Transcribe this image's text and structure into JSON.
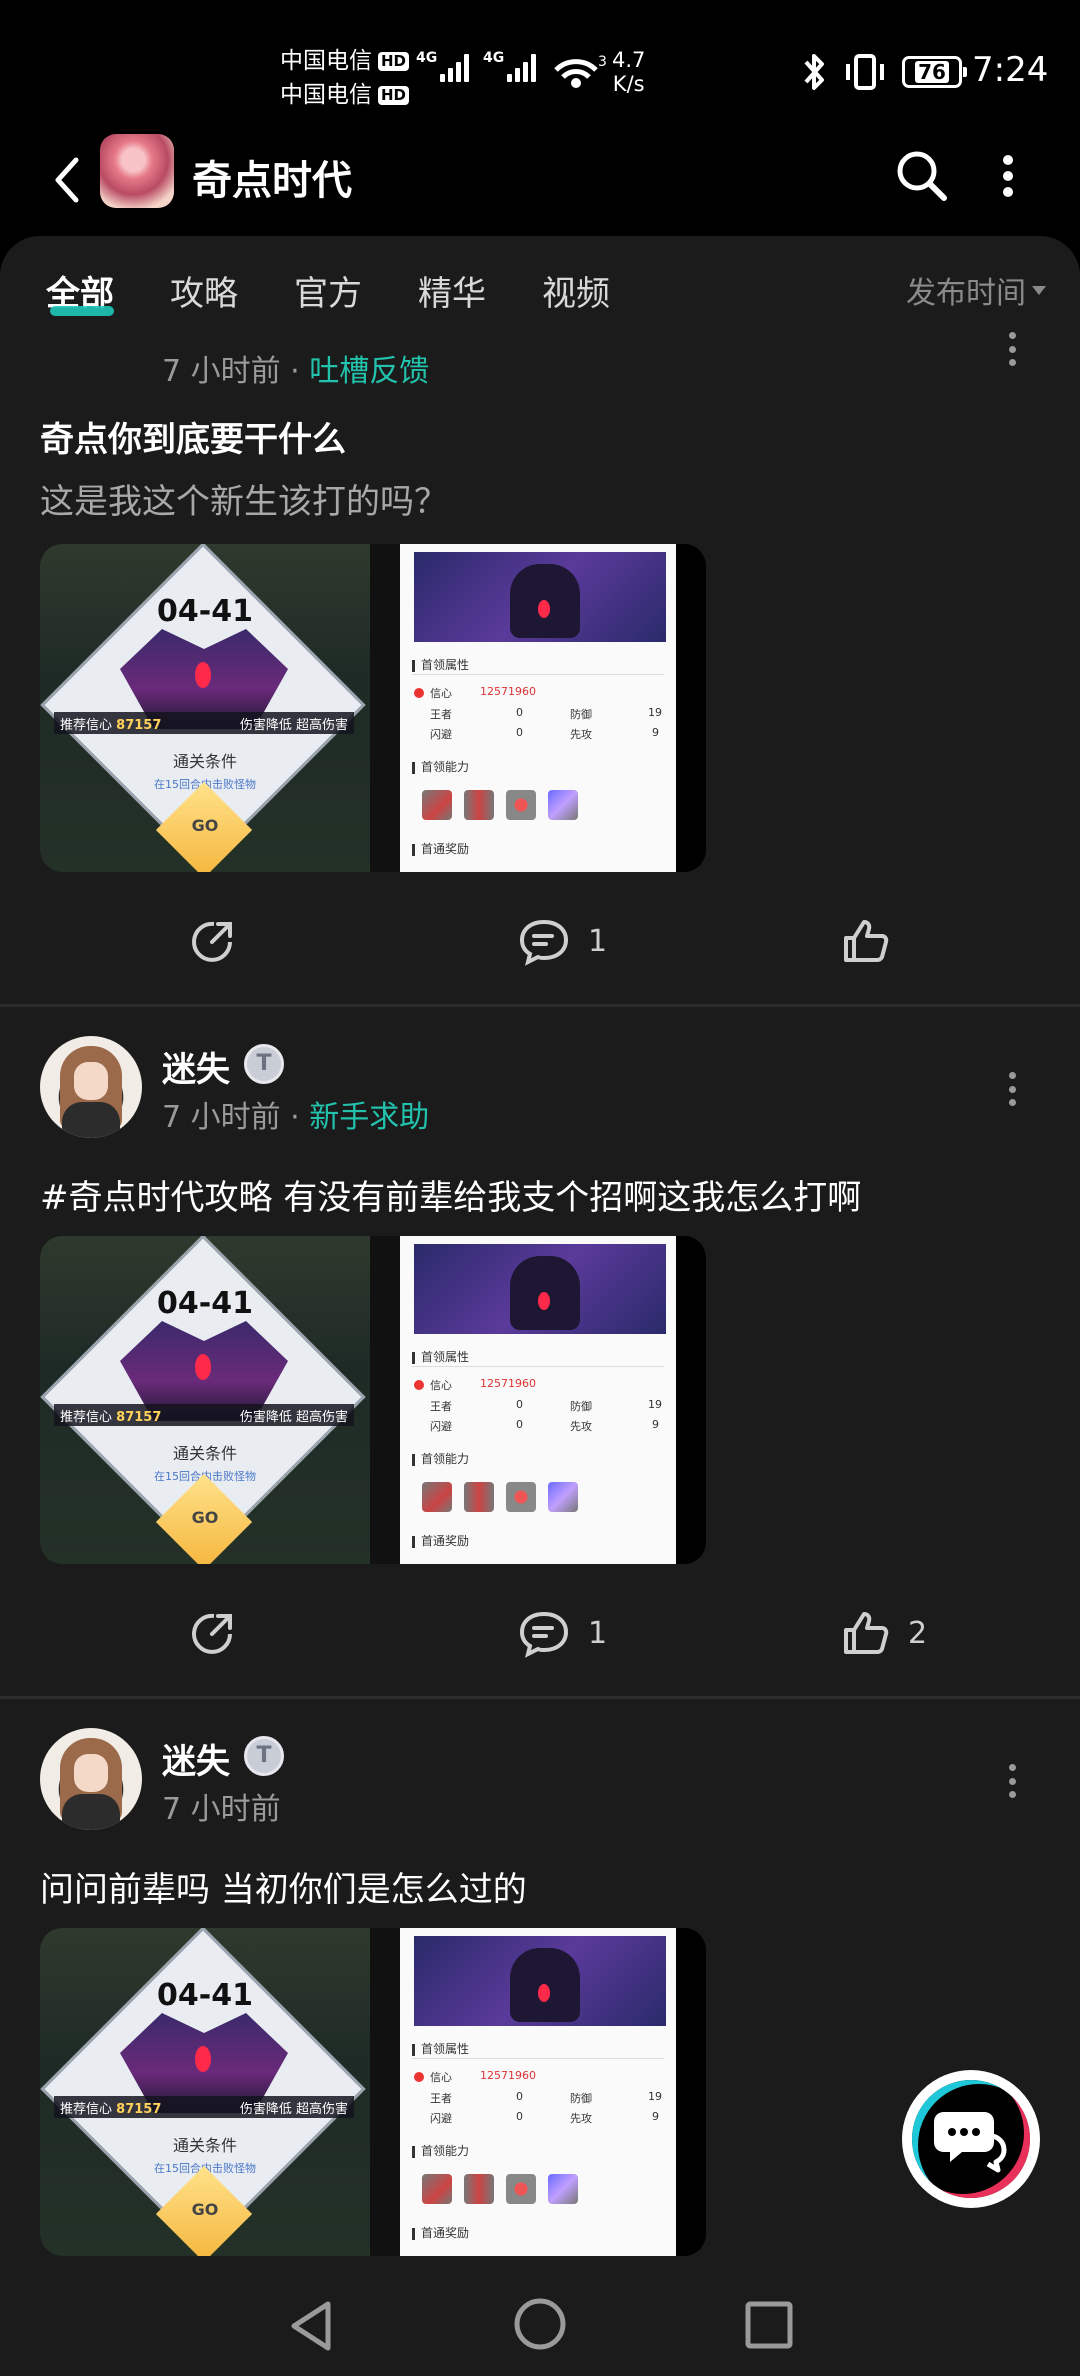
{
  "status_bar": {
    "carrier_1": "中国电信",
    "carrier_2": "中国电信",
    "hd_label": "HD",
    "network_1": "4G",
    "network_2": "4G",
    "wifi_badge": "3",
    "speed_value": "4.7",
    "speed_unit": "K/s",
    "battery": "76",
    "time": "7:24"
  },
  "app_bar": {
    "title": "奇点时代",
    "icons": [
      "back-icon",
      "search-icon",
      "more-vertical-icon"
    ]
  },
  "tabs": {
    "items": [
      "全部",
      "攻略",
      "官方",
      "精华",
      "视频"
    ],
    "active_index": 0,
    "sort_label": "发布时间"
  },
  "thumbnail": {
    "level": "04-41",
    "recommend_label": "推荐信心",
    "recommend_value": "87157",
    "tag_1": "伤害降低",
    "tag_2": "超高伤害",
    "clear_title": "通关条件",
    "clear_desc": "在15回合内击败怪物",
    "go": "GO",
    "attr_title": "首领属性",
    "hp_label": "信心",
    "hp_value": "12571960",
    "king_label": "王者",
    "king_value": "0",
    "def_label": "防御",
    "def_value": "19",
    "dodge_label": "闪避",
    "dodge_value": "0",
    "first_label": "先攻",
    "first_value": "9",
    "ability_title": "首领能力",
    "reward_title": "首通奖励"
  },
  "posts": [
    {
      "author": "",
      "time": "7 小时前",
      "tag": "吐槽反馈",
      "title": "奇点你到底要干什么",
      "body": "这是我这个新生该打的吗？",
      "comments": "1",
      "likes": ""
    },
    {
      "author": "迷失",
      "badge": "T",
      "time": "7 小时前",
      "tag": "新手求助",
      "text": "#奇点时代攻略 有没有前辈给我支个招啊这我怎么打啊",
      "comments": "1",
      "likes": "2"
    },
    {
      "author": "迷失",
      "badge": "T",
      "time": "7 小时前",
      "text": "问问前辈吗 当初你们是怎么过的"
    }
  ],
  "colors": {
    "accent": "#1ec8b8",
    "tag_text": "#22c2ad",
    "background": "#000000",
    "sheet": "#1b1b1b"
  }
}
